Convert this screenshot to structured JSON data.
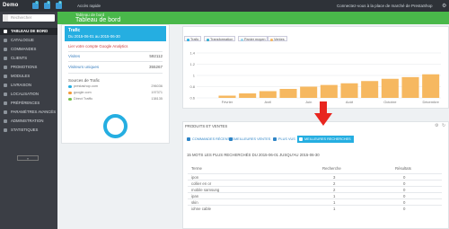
{
  "topbar": {
    "brand": "Demo",
    "notifications": [
      "1",
      "3",
      "9"
    ],
    "quick_access": "Accès rapide",
    "store_link": "Connectez-vous à la place de marché de PrestaShop"
  },
  "sidebar": {
    "search_placeholder": "Rechercher",
    "items": [
      {
        "label": "Tableau de bord",
        "active": true
      },
      {
        "label": "Catalogue"
      },
      {
        "label": "Commandes"
      },
      {
        "label": "Clients"
      },
      {
        "label": "Promotions"
      },
      {
        "label": "Modules"
      },
      {
        "label": "Livraison"
      },
      {
        "label": "Localisation"
      },
      {
        "label": "Préférences"
      },
      {
        "label": "Paramètres avancés"
      },
      {
        "label": "Administration"
      },
      {
        "label": "Statistiques"
      }
    ],
    "collapse_label": "«"
  },
  "header": {
    "breadcrumb": "Tableau de bord",
    "title": "Tableau de bord"
  },
  "traffic": {
    "title": "Trafic",
    "period": "Du 2015-06-01 au 2015-06-30",
    "ga_link": "Lier votre compte Google Analytics",
    "visits_label": "Visites",
    "visits_value": "592112",
    "visitors_label": "Visiteurs uniques",
    "visitors_value": "355267",
    "sources_title": "Sources de Trafic",
    "sources": [
      {
        "name": "prestashop.com",
        "value": "296036",
        "color": "#25aee1"
      },
      {
        "name": "google.com",
        "value": "197371",
        "color": "#f39b3b"
      },
      {
        "name": "Direct Traffic",
        "value": "138135",
        "color": "#76c24f"
      }
    ]
  },
  "chart_legend": [
    {
      "label": "Trafic",
      "color": "#25aee1"
    },
    {
      "label": "Transformation",
      "color": "#2eacce"
    },
    {
      "label": "Panier moyen",
      "color": "#9ad6ec"
    },
    {
      "label": "Ventes",
      "color": "#f6b860"
    }
  ],
  "chart_data": {
    "type": "bar",
    "categories": [
      "Janvier",
      "Février",
      "Mars",
      "Avril",
      "Mai",
      "Juin",
      "Juillet",
      "Août",
      "Septembre",
      "Octobre",
      "Novembre",
      "Décembre"
    ],
    "series": [
      {
        "name": "Ventes",
        "values": [
          0.6,
          0.64,
          0.68,
          0.72,
          0.76,
          0.8,
          0.83,
          0.86,
          0.9,
          0.94,
          0.97,
          1.02
        ]
      }
    ],
    "visible_xticks": [
      "Février",
      "Avril",
      "Juin",
      "Août",
      "Octobre",
      "Décembre"
    ],
    "yticks": [
      "1.4",
      "1.2",
      "1",
      "0.8",
      "0.6"
    ],
    "ylim": [
      0.6,
      1.4
    ],
    "bar_color": "#f6b860",
    "grid": true
  },
  "products": {
    "title": "Produits et ventes",
    "tabs": [
      {
        "label": "Commandes récentes"
      },
      {
        "label": "Meilleures ventes"
      },
      {
        "label": "Plus vus"
      },
      {
        "label": "Meilleures recherches",
        "active": true
      }
    ],
    "section_text": "15 mots les plus recherchés du 2015-06-01 jusqu'au 2015-06-30",
    "table": {
      "headers": [
        "Terme",
        "Recherche",
        "Résultats"
      ],
      "rows": [
        [
          "ipon",
          "3",
          "0"
        ],
        [
          "collier en or",
          "2",
          "0"
        ],
        [
          "mobile samsung",
          "2",
          "0"
        ],
        [
          "ipan",
          "1",
          "0"
        ],
        [
          "skin",
          "1",
          "0"
        ],
        [
          "iohne cable",
          "1",
          "0"
        ]
      ]
    }
  },
  "accent_colors": {
    "green": "#49b84a",
    "blue": "#25aee1",
    "arrow": "#e8261f"
  }
}
